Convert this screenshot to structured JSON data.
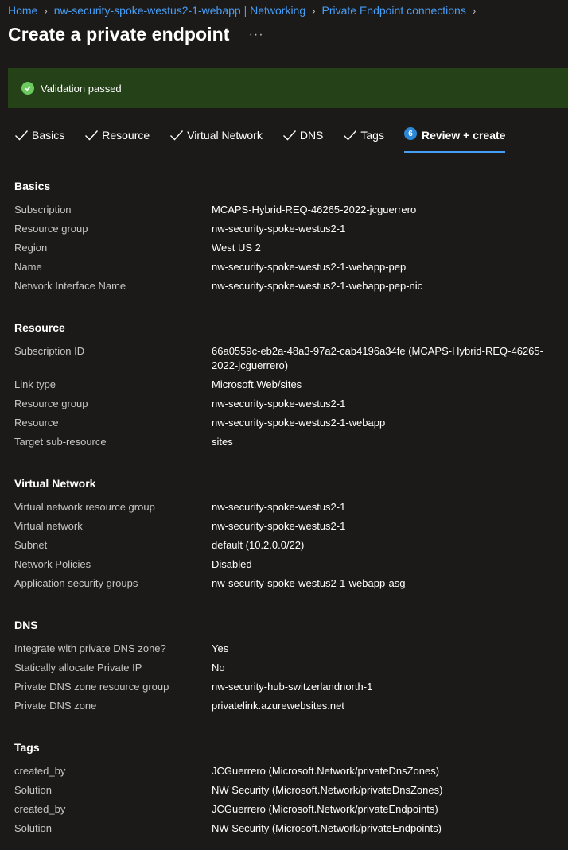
{
  "breadcrumb": [
    {
      "label": "Home"
    },
    {
      "label": "nw-security-spoke-westus2-1-webapp | Networking"
    },
    {
      "label": "Private Endpoint connections"
    }
  ],
  "page_title": "Create a private endpoint",
  "more_label": "···",
  "banner": {
    "text": "Validation passed",
    "color": "#254117"
  },
  "tabs": [
    {
      "label": "Basics"
    },
    {
      "label": "Resource"
    },
    {
      "label": "Virtual Network"
    },
    {
      "label": "DNS"
    },
    {
      "label": "Tags"
    },
    {
      "label": "Review + create",
      "step": "6"
    }
  ],
  "sections": {
    "basics": {
      "title": "Basics",
      "rows": [
        {
          "label": "Subscription",
          "value": "MCAPS-Hybrid-REQ-46265-2022-jcguerrero"
        },
        {
          "label": "Resource group",
          "value": "nw-security-spoke-westus2-1"
        },
        {
          "label": "Region",
          "value": "West US 2"
        },
        {
          "label": "Name",
          "value": "nw-security-spoke-westus2-1-webapp-pep"
        },
        {
          "label": "Network Interface Name",
          "value": "nw-security-spoke-westus2-1-webapp-pep-nic"
        }
      ]
    },
    "resource": {
      "title": "Resource",
      "rows": [
        {
          "label": "Subscription ID",
          "value": "66a0559c-eb2a-48a3-97a2-cab4196a34fe (MCAPS-Hybrid-REQ-46265-2022-jcguerrero)"
        },
        {
          "label": "Link type",
          "value": "Microsoft.Web/sites"
        },
        {
          "label": "Resource group",
          "value": "nw-security-spoke-westus2-1"
        },
        {
          "label": "Resource",
          "value": "nw-security-spoke-westus2-1-webapp"
        },
        {
          "label": "Target sub-resource",
          "value": "sites"
        }
      ]
    },
    "virtual_network": {
      "title": "Virtual Network",
      "rows": [
        {
          "label": "Virtual network resource group",
          "value": "nw-security-spoke-westus2-1"
        },
        {
          "label": "Virtual network",
          "value": "nw-security-spoke-westus2-1"
        },
        {
          "label": "Subnet",
          "value": "default (10.2.0.0/22)"
        },
        {
          "label": "Network Policies",
          "value": "Disabled"
        },
        {
          "label": "Application security groups",
          "value": "nw-security-spoke-westus2-1-webapp-asg"
        }
      ]
    },
    "dns": {
      "title": "DNS",
      "rows": [
        {
          "label": "Integrate with private DNS zone?",
          "value": "Yes"
        },
        {
          "label": "Statically allocate Private IP",
          "value": "No"
        },
        {
          "label": "Private DNS zone resource group",
          "value": "nw-security-hub-switzerlandnorth-1"
        },
        {
          "label": "Private DNS zone",
          "value": "privatelink.azurewebsites.net"
        }
      ]
    },
    "tags": {
      "title": "Tags",
      "rows": [
        {
          "label": "created_by",
          "value": "JCGuerrero (Microsoft.Network/privateDnsZones)"
        },
        {
          "label": "Solution",
          "value": "NW Security (Microsoft.Network/privateDnsZones)"
        },
        {
          "label": "created_by",
          "value": "JCGuerrero (Microsoft.Network/privateEndpoints)"
        },
        {
          "label": "Solution",
          "value": "NW Security (Microsoft.Network/privateEndpoints)"
        }
      ]
    }
  }
}
